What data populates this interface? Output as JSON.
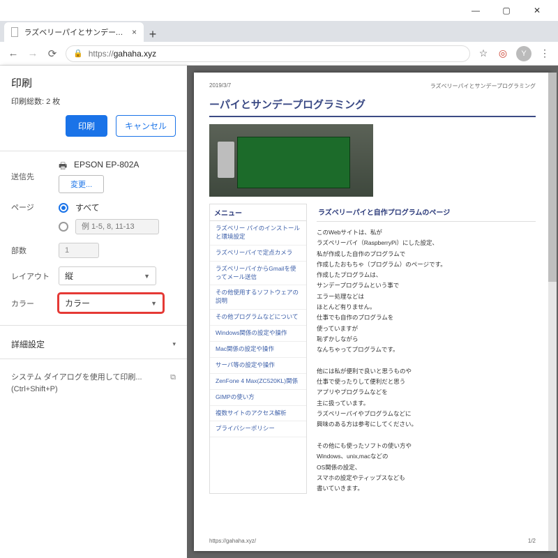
{
  "window_controls": {
    "min": "—",
    "max": "▢",
    "close": "✕"
  },
  "tab": {
    "title": "ラズベリーパイとサンデープログラミング",
    "close": "×"
  },
  "newtab": "+",
  "url": {
    "scheme": "https://",
    "host": "gahaha.xyz"
  },
  "toolbar_icons": {
    "star": "☆",
    "ext": "◎",
    "avatar": "Y",
    "menu": "⋮"
  },
  "nav": {
    "back": "←",
    "fwd": "→",
    "reload": "⟳",
    "lock": "🔒"
  },
  "print": {
    "title": "印刷",
    "total": "印刷総数: 2 枚",
    "print_btn": "印刷",
    "cancel_btn": "キャンセル",
    "dest_label": "送信先",
    "dest_value": "EPSON EP-802A",
    "change_btn": "変更...",
    "pages_label": "ページ",
    "pages_all": "すべて",
    "pages_example": "例 1-5, 8, 11-13",
    "copies_label": "部数",
    "copies_value": "1",
    "layout_label": "レイアウト",
    "layout_value": "縦",
    "color_label": "カラー",
    "color_value": "カラー",
    "advanced": "詳細設定",
    "sysdlg_line1": "システム ダイアログを使用して印刷...",
    "sysdlg_line2": "(Ctrl+Shift+P)"
  },
  "preview": {
    "header_date": "2019/3/7",
    "header_title": "ラズベリーパイとサンデープログラミング",
    "page_title": "ーパイとサンデープログラミング",
    "menu_head": "メニュー",
    "menu_items": [
      "ラズベリー パイのインストールと環境設定",
      "ラズベリーパイで定点カメラ",
      "ラズベリーパイからGmailを使ってメール送信",
      "その他使用するソフトウェアの説明",
      "その他プログラムなどについて",
      "Windows関係の設定や操作",
      "Mac関係の設定や操作",
      "サーバ等の設定や操作",
      "ZenFone 4 Max(ZC520KL)関係",
      "GIMPの使い方",
      "複数サイトのアクセス解析",
      "プライバシーポリシー"
    ],
    "content_head": "ラズベリーパイと自作プログラムのページ",
    "content_body": "このWebサイトは、私が\nラズベリーパイ（RaspberryPi）にした設定、\n私が作成した自作のプログラムで\n作成したおもちゃ（プログラム）のページです。\n作成したプログラムは、\nサンデープログラムという事で\nエラー処理などは\nほとんど有りません。\n仕事でも自作のプログラムを\n使っていますが\n恥ずかしながら\nなんちゃってプログラムです。\n\n他には私が便利で良いと思うものや\n仕事で使ったりして便利だと思う\nアプリやプログラムなどを\n主に扱っています。\nラズベリーパイやプログラムなどに\n興味のある方は参考にしてください。\n\nその他にも使ったソフトの使い方や\nWindows、unix,macなどの\nOS関係の設定、\nスマホの設定やティップスなども\n書いていきます。",
    "footer_url": "https://gahaha.xyz/",
    "footer_page": "1/2"
  }
}
